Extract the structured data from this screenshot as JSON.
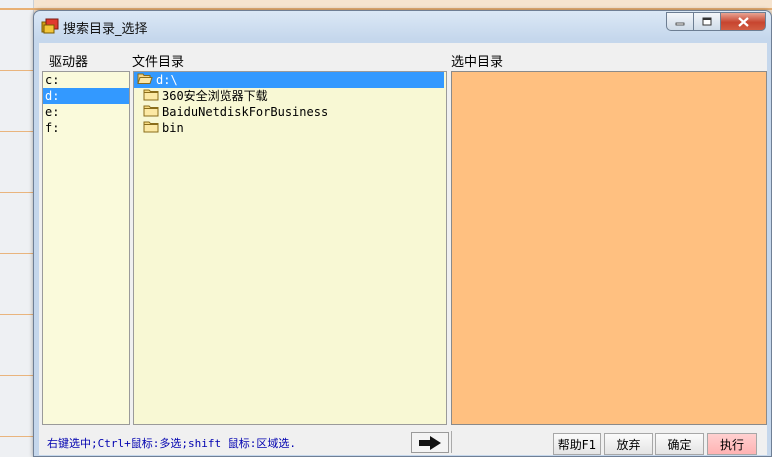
{
  "window": {
    "title": "搜索目录_选择",
    "minimize_icon": "minimize-icon",
    "maximize_icon": "maximize-icon",
    "close_icon": "close-icon"
  },
  "columns": {
    "drives": "驱动器",
    "directories": "文件目录",
    "selected": "选中目录"
  },
  "drives": {
    "items": [
      {
        "label": "c:",
        "selected": false
      },
      {
        "label": "d:",
        "selected": true
      },
      {
        "label": "e:",
        "selected": false
      },
      {
        "label": "f:",
        "selected": false
      }
    ]
  },
  "directories": {
    "items": [
      {
        "label": "d:\\",
        "icon": "open-folder-icon",
        "selected": true,
        "indent": 0
      },
      {
        "label": "360安全浏览器下载",
        "icon": "folder-icon",
        "selected": false,
        "indent": 1
      },
      {
        "label": "BaiduNetdiskForBusiness",
        "icon": "folder-icon",
        "selected": false,
        "indent": 1
      },
      {
        "label": "bin",
        "icon": "folder-icon",
        "selected": false,
        "indent": 1
      }
    ]
  },
  "selected_directories": [],
  "status": {
    "hint": "右键选中;Ctrl+鼠标:多选;shift 鼠标:区域选."
  },
  "buttons": {
    "add_arrow_icon": "right-arrow-icon",
    "help": "帮助F1",
    "cancel": "放弃",
    "ok": "确定",
    "run": "执行"
  },
  "colors": {
    "selection": "#3399ff",
    "selected_panel": "#ffc080",
    "list_background": "#f8f8d4",
    "hint_text": "#0000b0",
    "run_button": "#ffb3b3"
  }
}
